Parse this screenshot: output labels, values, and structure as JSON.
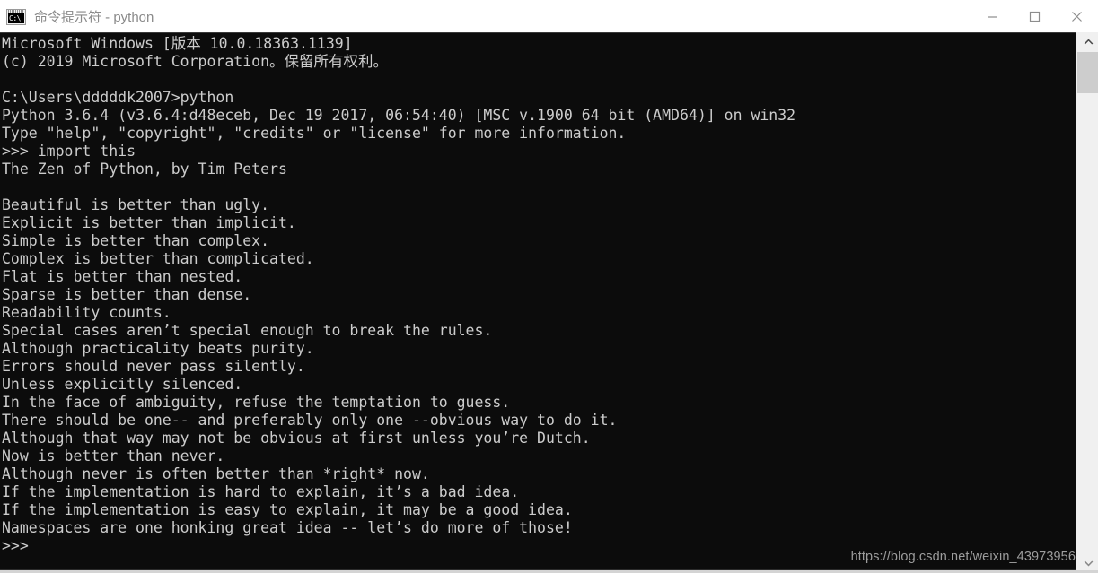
{
  "window": {
    "title": "命令提示符 - python",
    "icon_name": "cmd-icon",
    "icon_text": "C:\\",
    "background": "#0c0c0c",
    "text_color": "#cccccc",
    "titlebar_background": "#ffffff",
    "title_color": "#8a8a8a"
  },
  "titlebar": {
    "minimize_label": "Minimize",
    "maximize_label": "Maximize",
    "close_label": "Close"
  },
  "console": {
    "lines": [
      "Microsoft Windows [版本 10.0.18363.1139]",
      "(c) 2019 Microsoft Corporation。保留所有权利。",
      "",
      "C:\\Users\\dddddk2007>python",
      "Python 3.6.4 (v3.6.4:d48eceb, Dec 19 2017, 06:54:40) [MSC v.1900 64 bit (AMD64)] on win32",
      "Type \"help\", \"copyright\", \"credits\" or \"license\" for more information.",
      ">>> import this",
      "The Zen of Python, by Tim Peters",
      "",
      "Beautiful is better than ugly.",
      "Explicit is better than implicit.",
      "Simple is better than complex.",
      "Complex is better than complicated.",
      "Flat is better than nested.",
      "Sparse is better than dense.",
      "Readability counts.",
      "Special cases aren’t special enough to break the rules.",
      "Although practicality beats purity.",
      "Errors should never pass silently.",
      "Unless explicitly silenced.",
      "In the face of ambiguity, refuse the temptation to guess.",
      "There should be one-- and preferably only one --obvious way to do it.",
      "Although that way may not be obvious at first unless you’re Dutch.",
      "Now is better than never.",
      "Although never is often better than *right* now.",
      "If the implementation is hard to explain, it’s a bad idea.",
      "If the implementation is easy to explain, it may be a good idea.",
      "Namespaces are one honking great idea -- let’s do more of those!",
      ">>>"
    ]
  },
  "scrollbar": {
    "up_arrow_name": "scroll-up-arrow",
    "down_arrow_name": "scroll-down-arrow"
  },
  "watermark": {
    "text": "https://blog.csdn.net/weixin_43973956"
  }
}
